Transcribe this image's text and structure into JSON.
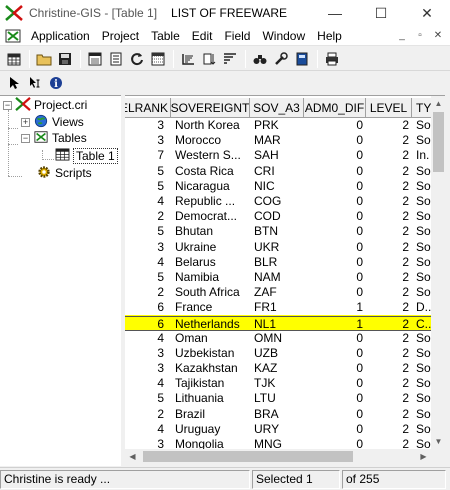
{
  "window": {
    "app_title": "Christine-GIS - [Table 1]",
    "doc_title": "LIST OF FREEWARE",
    "controls": {
      "minimize": "—",
      "maximize": "☐",
      "close": "✕"
    }
  },
  "menubar": {
    "items": [
      {
        "label": "Application"
      },
      {
        "label": "Project"
      },
      {
        "label": "Table"
      },
      {
        "label": "Edit"
      },
      {
        "label": "Field"
      },
      {
        "label": "Window"
      },
      {
        "label": "Help"
      }
    ],
    "mdi_controls": {
      "minimize": "_",
      "restore": "▫",
      "close": "✕"
    }
  },
  "toolbar": {
    "buttons": [
      "new-table-icon",
      "open-folder-icon",
      "save-icon",
      "copy-icon",
      "paste-icon",
      "refresh-icon",
      "table-props-icon",
      "sort-ascending-icon",
      "sort-descending-icon",
      "query-icon",
      "find-icon",
      "tools-icon",
      "calculator-icon",
      "print-icon"
    ]
  },
  "toolbar2": {
    "buttons": [
      "select-arrow-icon",
      "identify-icon",
      "info-icon"
    ]
  },
  "tree": {
    "root": "Project.cri",
    "views": "Views",
    "tables": "Tables",
    "table1": "Table 1",
    "scripts": "Scripts"
  },
  "table": {
    "columns": [
      "ELRANK",
      "SOVEREIGNT",
      "SOV_A3",
      "ADM0_DIF",
      "LEVEL",
      "TY"
    ],
    "rows": [
      {
        "rank": "3",
        "sov": "North Korea",
        "sov3": "PRK",
        "adm": "0",
        "level": "2",
        "ty": "So"
      },
      {
        "rank": "3",
        "sov": "Morocco",
        "sov3": "MAR",
        "adm": "0",
        "level": "2",
        "ty": "So"
      },
      {
        "rank": "7",
        "sov": "Western S...",
        "sov3": "SAH",
        "adm": "0",
        "level": "2",
        "ty": "In."
      },
      {
        "rank": "5",
        "sov": "Costa Rica",
        "sov3": "CRI",
        "adm": "0",
        "level": "2",
        "ty": "So"
      },
      {
        "rank": "5",
        "sov": "Nicaragua",
        "sov3": "NIC",
        "adm": "0",
        "level": "2",
        "ty": "So"
      },
      {
        "rank": "4",
        "sov": "Republic ...",
        "sov3": "COG",
        "adm": "0",
        "level": "2",
        "ty": "So"
      },
      {
        "rank": "2",
        "sov": "Democrat...",
        "sov3": "COD",
        "adm": "0",
        "level": "2",
        "ty": "So"
      },
      {
        "rank": "5",
        "sov": "Bhutan",
        "sov3": "BTN",
        "adm": "0",
        "level": "2",
        "ty": "So"
      },
      {
        "rank": "3",
        "sov": "Ukraine",
        "sov3": "UKR",
        "adm": "0",
        "level": "2",
        "ty": "So"
      },
      {
        "rank": "4",
        "sov": "Belarus",
        "sov3": "BLR",
        "adm": "0",
        "level": "2",
        "ty": "So"
      },
      {
        "rank": "5",
        "sov": "Namibia",
        "sov3": "NAM",
        "adm": "0",
        "level": "2",
        "ty": "So"
      },
      {
        "rank": "2",
        "sov": "South Africa",
        "sov3": "ZAF",
        "adm": "0",
        "level": "2",
        "ty": "So"
      },
      {
        "rank": "6",
        "sov": "France",
        "sov3": "FR1",
        "adm": "1",
        "level": "2",
        "ty": "D.."
      },
      {
        "rank": "6",
        "sov": "Netherlands",
        "sov3": "NL1",
        "adm": "1",
        "level": "2",
        "ty": "C..",
        "highlight": true
      },
      {
        "rank": "4",
        "sov": "Oman",
        "sov3": "OMN",
        "adm": "0",
        "level": "2",
        "ty": "So"
      },
      {
        "rank": "3",
        "sov": "Uzbekistan",
        "sov3": "UZB",
        "adm": "0",
        "level": "2",
        "ty": "So"
      },
      {
        "rank": "3",
        "sov": "Kazakhstan",
        "sov3": "KAZ",
        "adm": "0",
        "level": "2",
        "ty": "So"
      },
      {
        "rank": "4",
        "sov": "Tajikistan",
        "sov3": "TJK",
        "adm": "0",
        "level": "2",
        "ty": "So"
      },
      {
        "rank": "5",
        "sov": "Lithuania",
        "sov3": "LTU",
        "adm": "0",
        "level": "2",
        "ty": "So"
      },
      {
        "rank": "2",
        "sov": "Brazil",
        "sov3": "BRA",
        "adm": "0",
        "level": "2",
        "ty": "So"
      },
      {
        "rank": "4",
        "sov": "Uruguay",
        "sov3": "URY",
        "adm": "0",
        "level": "2",
        "ty": "So"
      },
      {
        "rank": "3",
        "sov": "Mongolia",
        "sov3": "MNG",
        "adm": "0",
        "level": "2",
        "ty": "So"
      }
    ]
  },
  "statusbar": {
    "message": "Christine is ready ...",
    "selected": "Selected 1",
    "total": "of 255"
  },
  "colors": {
    "highlight": "#ffff00"
  }
}
